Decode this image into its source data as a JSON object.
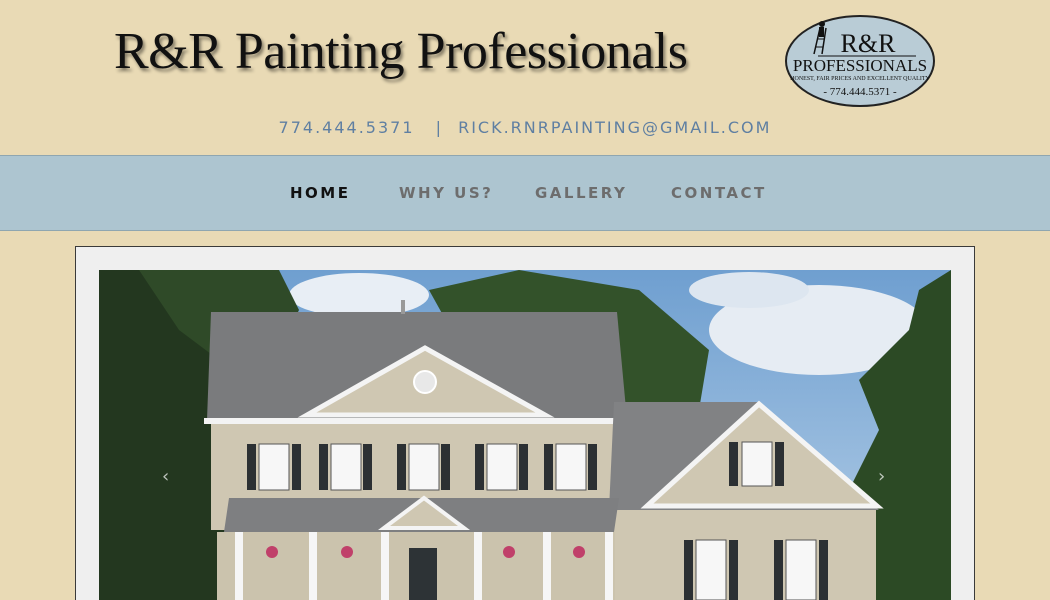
{
  "header": {
    "site_title": "R&R Painting Professionals",
    "logo": {
      "line1": "R&R",
      "line2": "PROFESSIONALS",
      "tagline": "HONEST, FAIR PRICES AND EXCELLENT QUALITY",
      "phone": "- 774.444.5371 -"
    },
    "phone": "774.444.5371",
    "separator": "|",
    "email": "RICK.RNRPAINTING@GMAIL.COM"
  },
  "nav": {
    "items": [
      {
        "label": "HOME",
        "active": true
      },
      {
        "label": "WHY US?",
        "active": false
      },
      {
        "label": "GALLERY",
        "active": false
      },
      {
        "label": "CONTACT",
        "active": false
      }
    ]
  },
  "slider": {
    "prev_label": "‹",
    "next_label": "›"
  },
  "colors": {
    "page_bg": "#e9dab5",
    "nav_bg": "#adc5d0",
    "link": "#5f7fa2",
    "house_siding": "#cfc7b2",
    "roof": "#7a7b7d",
    "shutters": "#2c3033"
  }
}
